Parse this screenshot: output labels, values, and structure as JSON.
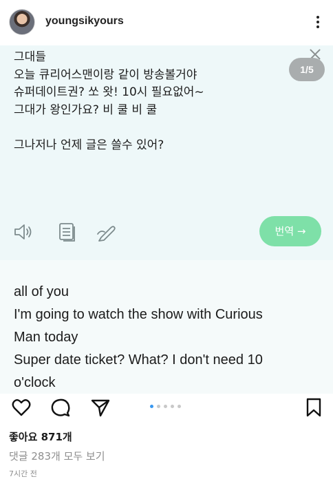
{
  "post": {
    "username": "youngsikyours",
    "counter": "1/5"
  },
  "original_text": {
    "lines": [
      "그대들",
      "오늘 큐리어스맨이랑 같이 방송볼거야",
      "슈퍼데이트권? 쏘 왓! 10시 필요없어~",
      "그대가 왕인가요? 비 쿨 비 쿨",
      "",
      "그나저나 언제 글은 쓸수 있어?"
    ]
  },
  "translate_button": {
    "label": "번역 →"
  },
  "translation": {
    "lines": [
      "all of you",
      "I'm going to watch the show with Curious",
      "Man today",
      "Super date ticket? What? I don't need 10",
      "o'clock"
    ]
  },
  "footer": {
    "likes": "좋아요 871개",
    "comments": "댓글 283개 모두 보기",
    "time": "7시간 전"
  },
  "carousel": {
    "total": 5,
    "active_index": 0
  },
  "colors": {
    "card_top": "#eef8f9",
    "translate_button": "#7ee0a8",
    "counter_badge": "#a9adae",
    "active_dot": "#3897f0"
  },
  "icons": {
    "tools": [
      "speaker-icon",
      "copy-icon",
      "edit-icon"
    ],
    "actions": [
      "heart-icon",
      "comment-icon",
      "share-icon",
      "bookmark-icon"
    ]
  }
}
